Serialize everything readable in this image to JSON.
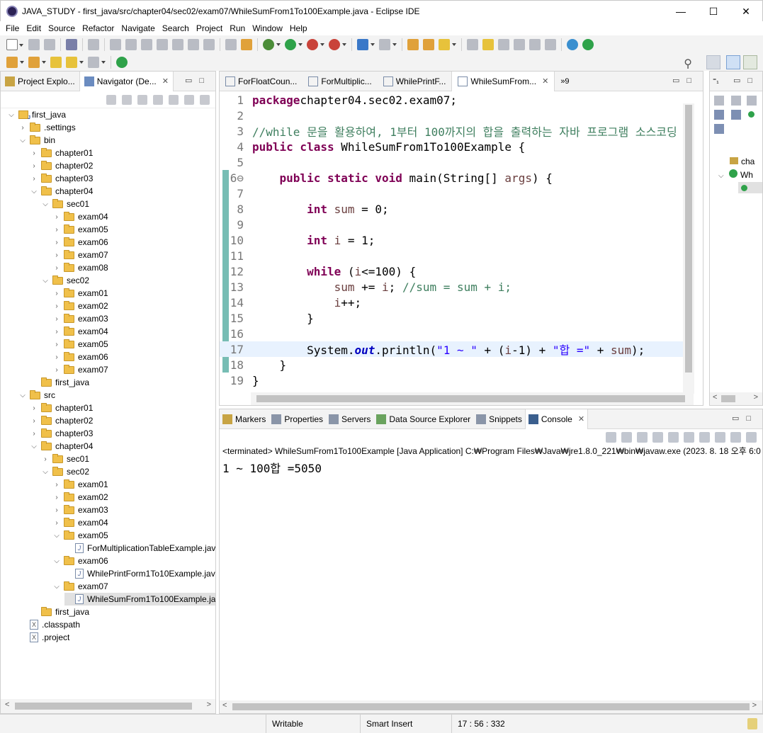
{
  "window": {
    "title": "JAVA_STUDY - first_java/src/chapter04/sec02/exam07/WhileSumFrom1To100Example.java - Eclipse IDE",
    "minimize": "—",
    "maximize": "☐",
    "close": "✕"
  },
  "menu": [
    "File",
    "Edit",
    "Source",
    "Refactor",
    "Navigate",
    "Search",
    "Project",
    "Run",
    "Window",
    "Help"
  ],
  "left_panel": {
    "tabs": [
      {
        "label": "Project Explo..."
      },
      {
        "label": "Navigator (De..."
      }
    ],
    "tree": [
      {
        "label": "first_java",
        "type": "project",
        "depth": 0,
        "expanded": true
      },
      {
        "label": ".settings",
        "type": "folder",
        "depth": 1,
        "expanded": false
      },
      {
        "label": "bin",
        "type": "folder",
        "depth": 1,
        "expanded": true
      },
      {
        "label": "chapter01",
        "type": "folder",
        "depth": 2,
        "expanded": false
      },
      {
        "label": "chapter02",
        "type": "folder",
        "depth": 2,
        "expanded": false
      },
      {
        "label": "chapter03",
        "type": "folder",
        "depth": 2,
        "expanded": false
      },
      {
        "label": "chapter04",
        "type": "folder",
        "depth": 2,
        "expanded": true
      },
      {
        "label": "sec01",
        "type": "folder",
        "depth": 3,
        "expanded": true
      },
      {
        "label": "exam04",
        "type": "folder",
        "depth": 4,
        "expanded": false
      },
      {
        "label": "exam05",
        "type": "folder",
        "depth": 4,
        "expanded": false
      },
      {
        "label": "exam06",
        "type": "folder",
        "depth": 4,
        "expanded": false
      },
      {
        "label": "exam07",
        "type": "folder",
        "depth": 4,
        "expanded": false
      },
      {
        "label": "exam08",
        "type": "folder",
        "depth": 4,
        "expanded": false
      },
      {
        "label": "sec02",
        "type": "folder",
        "depth": 3,
        "expanded": true
      },
      {
        "label": "exam01",
        "type": "folder",
        "depth": 4,
        "expanded": false
      },
      {
        "label": "exam02",
        "type": "folder",
        "depth": 4,
        "expanded": false
      },
      {
        "label": "exam03",
        "type": "folder",
        "depth": 4,
        "expanded": false
      },
      {
        "label": "exam04",
        "type": "folder",
        "depth": 4,
        "expanded": false
      },
      {
        "label": "exam05",
        "type": "folder",
        "depth": 4,
        "expanded": false
      },
      {
        "label": "exam06",
        "type": "folder",
        "depth": 4,
        "expanded": false
      },
      {
        "label": "exam07",
        "type": "folder",
        "depth": 4,
        "expanded": false
      },
      {
        "label": "first_java",
        "type": "folder",
        "depth": 2,
        "expanded": null
      },
      {
        "label": "src",
        "type": "folder",
        "depth": 1,
        "expanded": true
      },
      {
        "label": "chapter01",
        "type": "folder",
        "depth": 2,
        "expanded": false
      },
      {
        "label": "chapter02",
        "type": "folder",
        "depth": 2,
        "expanded": false
      },
      {
        "label": "chapter03",
        "type": "folder",
        "depth": 2,
        "expanded": false
      },
      {
        "label": "chapter04",
        "type": "folder",
        "depth": 2,
        "expanded": true
      },
      {
        "label": "sec01",
        "type": "folder",
        "depth": 3,
        "expanded": false
      },
      {
        "label": "sec02",
        "type": "folder",
        "depth": 3,
        "expanded": true
      },
      {
        "label": "exam01",
        "type": "folder",
        "depth": 4,
        "expanded": false
      },
      {
        "label": "exam02",
        "type": "folder",
        "depth": 4,
        "expanded": false
      },
      {
        "label": "exam03",
        "type": "folder",
        "depth": 4,
        "expanded": false
      },
      {
        "label": "exam04",
        "type": "folder",
        "depth": 4,
        "expanded": false
      },
      {
        "label": "exam05",
        "type": "folder",
        "depth": 4,
        "expanded": true
      },
      {
        "label": "ForMultiplicationTableExample.jav",
        "type": "java",
        "depth": 5,
        "expanded": null
      },
      {
        "label": "exam06",
        "type": "folder",
        "depth": 4,
        "expanded": true
      },
      {
        "label": "WhilePrintForm1To10Example.jav",
        "type": "java",
        "depth": 5,
        "expanded": null
      },
      {
        "label": "exam07",
        "type": "folder",
        "depth": 4,
        "expanded": true
      },
      {
        "label": "WhileSumFrom1To100Example.ja",
        "type": "java",
        "depth": 5,
        "expanded": null,
        "selected": true
      },
      {
        "label": "first_java",
        "type": "folder",
        "depth": 2,
        "expanded": null
      },
      {
        "label": ".classpath",
        "type": "xml",
        "depth": 1,
        "expanded": null
      },
      {
        "label": ".project",
        "type": "xml",
        "depth": 1,
        "expanded": null
      }
    ]
  },
  "editor": {
    "tabs": [
      {
        "label": "ForFloatCoun..."
      },
      {
        "label": "ForMultiplic..."
      },
      {
        "label": "WhilePrintF..."
      },
      {
        "label": "WhileSumFrom...",
        "active": true
      }
    ],
    "overflow": "»9",
    "lines": [
      {
        "n": "1",
        "parts": [
          [
            "kw",
            "package"
          ],
          [
            "",
            "chapter04.sec02.exam07;"
          ]
        ]
      },
      {
        "n": "2",
        "parts": []
      },
      {
        "n": "3",
        "parts": [
          [
            "cm",
            "//while 문을 활용하여, 1부터 100까지의 합을 출력하는 자바 프로그램 소스코딩"
          ]
        ]
      },
      {
        "n": "4",
        "parts": [
          [
            "kw",
            "public class"
          ],
          [
            "",
            " WhileSumFrom1To100Example {"
          ]
        ]
      },
      {
        "n": "5",
        "parts": []
      },
      {
        "n": "6⊖",
        "parts": [
          [
            "",
            "    "
          ],
          [
            "kw",
            "public static void"
          ],
          [
            "",
            " main(String[] "
          ],
          [
            "var",
            "args"
          ],
          [
            "",
            ") {"
          ]
        ]
      },
      {
        "n": "7",
        "parts": []
      },
      {
        "n": "8",
        "parts": [
          [
            "",
            "        "
          ],
          [
            "kw",
            "int"
          ],
          [
            "",
            " "
          ],
          [
            "var",
            "sum"
          ],
          [
            "",
            " = 0;"
          ]
        ]
      },
      {
        "n": "9",
        "parts": []
      },
      {
        "n": "10",
        "parts": [
          [
            "",
            "        "
          ],
          [
            "kw",
            "int"
          ],
          [
            "",
            " "
          ],
          [
            "var",
            "i"
          ],
          [
            "",
            " = 1;"
          ]
        ]
      },
      {
        "n": "11",
        "parts": []
      },
      {
        "n": "12",
        "parts": [
          [
            "",
            "        "
          ],
          [
            "kw",
            "while"
          ],
          [
            "",
            " ("
          ],
          [
            "var",
            "i"
          ],
          [
            "",
            "<=100) {"
          ]
        ]
      },
      {
        "n": "13",
        "parts": [
          [
            "",
            "            "
          ],
          [
            "var",
            "sum"
          ],
          [
            "",
            " += "
          ],
          [
            "var",
            "i"
          ],
          [
            "",
            "; "
          ],
          [
            "cm",
            "//sum = sum + i;"
          ]
        ]
      },
      {
        "n": "14",
        "parts": [
          [
            "",
            "            "
          ],
          [
            "var",
            "i"
          ],
          [
            "",
            "++;"
          ]
        ]
      },
      {
        "n": "15",
        "parts": [
          [
            "",
            "        }"
          ]
        ]
      },
      {
        "n": "16",
        "parts": []
      },
      {
        "n": "17",
        "parts": [
          [
            "",
            "        System."
          ],
          [
            "fld",
            "out"
          ],
          [
            "",
            ".println("
          ],
          [
            "st",
            "\"1 ~ \""
          ],
          [
            "",
            " + ("
          ],
          [
            "var",
            "i"
          ],
          [
            "",
            "-1) + "
          ],
          [
            "st",
            "\"합 =\""
          ],
          [
            "",
            " + "
          ],
          [
            "var",
            "sum"
          ],
          [
            "",
            ");"
          ]
        ],
        "current": true
      },
      {
        "n": "18",
        "parts": [
          [
            "",
            "    }"
          ]
        ]
      },
      {
        "n": "19",
        "parts": [
          [
            "",
            "}"
          ]
        ]
      }
    ]
  },
  "outline": {
    "items": [
      "cha",
      "Wh"
    ]
  },
  "console_panel": {
    "tabs": [
      {
        "label": "Markers"
      },
      {
        "label": "Properties"
      },
      {
        "label": "Servers"
      },
      {
        "label": "Data Source Explorer"
      },
      {
        "label": "Snippets"
      },
      {
        "label": "Console",
        "active": true
      }
    ],
    "header": "<terminated> WhileSumFrom1To100Example [Java Application] C:₩Program Files₩Java₩jre1.8.0_221₩bin₩javaw.exe  (2023. 8. 18 오후 6:0",
    "output": "1 ~ 100합 =5050"
  },
  "status": {
    "writable": "Writable",
    "insert_mode": "Smart Insert",
    "position": "17 : 56 : 332"
  },
  "colors": {
    "keyword": "#7f0055",
    "comment": "#3f7f5f",
    "string": "#2a00ff",
    "variable": "#6a3e3e",
    "current_line": "#e8f2fe"
  }
}
